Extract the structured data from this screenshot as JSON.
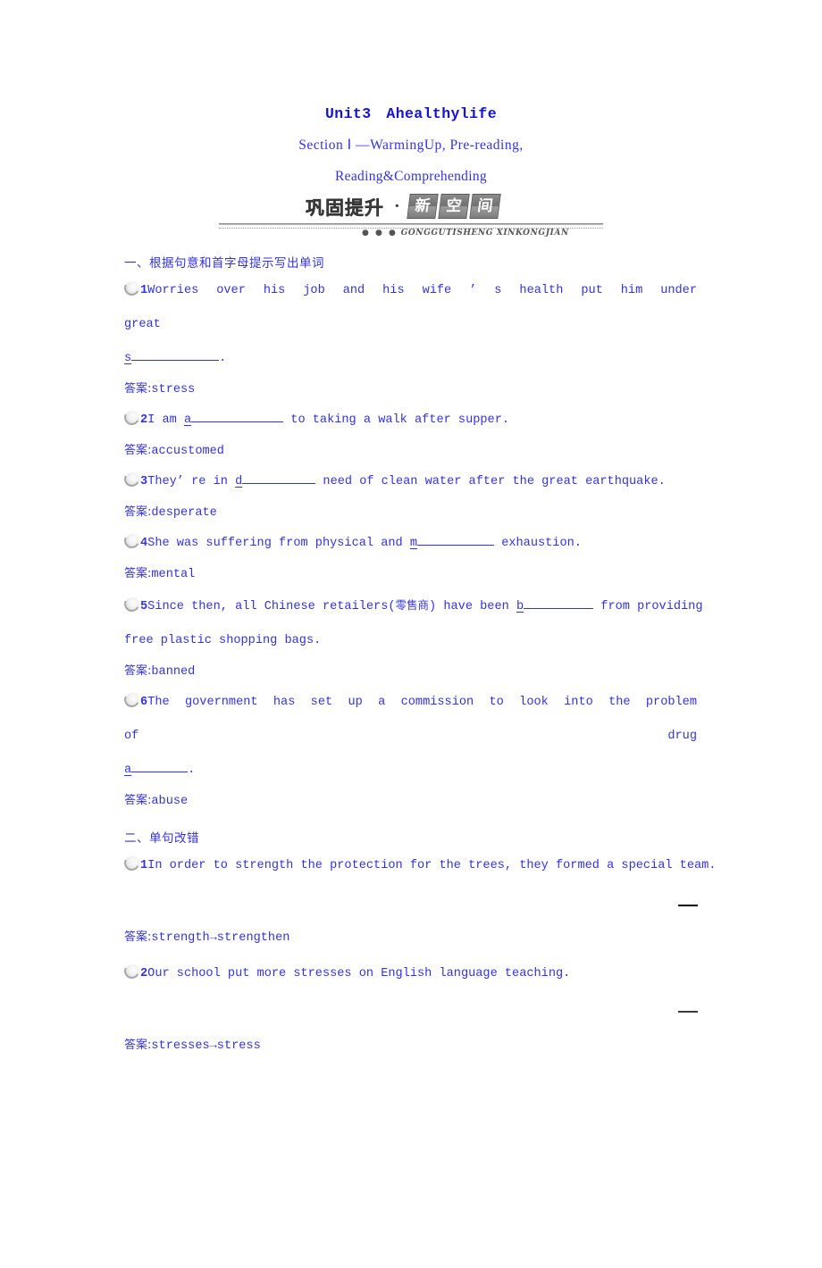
{
  "header": {
    "unit_title": "Unit3 Ahealthylife",
    "section_line1": "Section Ⅰ —WarmingUp, Pre-reading,",
    "section_line2": "Reading&Comprehending"
  },
  "banner": {
    "cn_text": "巩固提升",
    "separator": "·",
    "boxes": [
      "新",
      "空",
      "间"
    ],
    "pinyin_dots": "● ● ●",
    "pinyin": "GONGGUTISHENG XINKONGJIAN"
  },
  "sections": [
    {
      "heading": "一、根据句意和首字母提示写出单词",
      "questions": [
        {
          "number": "1",
          "line1_a": "Worries over his job and his wife ’ s health put him under great",
          "line2_prefix": "s",
          "line2_suffix": ".",
          "answer_label": "答案:",
          "answer": "stress"
        },
        {
          "number": "2",
          "text_before": "I am ",
          "blank_letter": "a",
          "text_after": " to taking a walk after supper.",
          "answer_label": "答案:",
          "answer": "accustomed"
        },
        {
          "number": "3",
          "text_before": "They’ re in ",
          "blank_letter": "d",
          "text_after": " need of clean water after the great earthquake.",
          "answer_label": "答案:",
          "answer": "desperate"
        },
        {
          "number": "4",
          "text_before": "She was suffering from physical and ",
          "blank_letter": "m",
          "text_after": " exhaustion.",
          "answer_label": "答案:",
          "answer": "mental"
        },
        {
          "number": "5",
          "text_before": "Since then, all Chinese retailers(",
          "cn_gloss": "零售商",
          "text_mid": ") have been ",
          "blank_letter": "b",
          "text_after": " from providing",
          "line2": "free plastic shopping bags.",
          "answer_label": "答案:",
          "answer": "banned"
        },
        {
          "number": "6",
          "line1": "The government has set up a commission to look into the problem of drug",
          "line2_prefix": "a",
          "line2_suffix": ".",
          "answer_label": "答案:",
          "answer": "abuse"
        }
      ]
    },
    {
      "heading": "二、单句改错",
      "questions": [
        {
          "number": "1",
          "text": "In order to strength the protection for the trees, they formed a special team.",
          "answer_label": "答案:",
          "answer": "strength→strengthen"
        },
        {
          "number": "2",
          "text": "Our school put more stresses on English language teaching.",
          "answer_label": "答案:",
          "answer": "stresses→stress"
        }
      ]
    }
  ],
  "colors": {
    "text_blue": "#3333dd",
    "title_blue": "#1414d2",
    "mark_black": "#000000"
  }
}
